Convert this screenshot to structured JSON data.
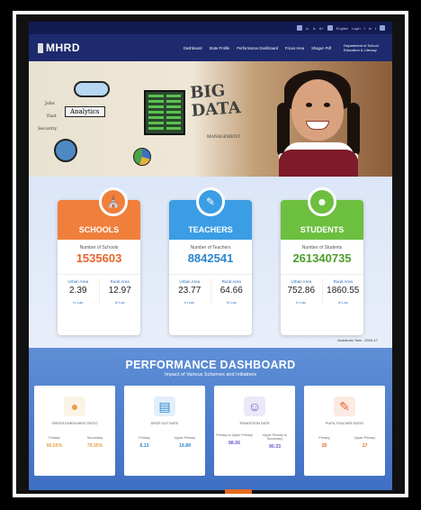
{
  "topbar": {
    "items": [
      "A-",
      "A",
      "A+",
      "English",
      "Login"
    ],
    "social": [
      "f",
      "in",
      "t"
    ]
  },
  "nav": {
    "brand": "MHRD",
    "menu": [
      "Dashboard",
      "State Profile",
      "Performance Dashboard",
      "Focus Area",
      "Shagun Pdf"
    ],
    "dept": "Department of School Education & Literacy"
  },
  "hero": {
    "big": "BIG",
    "data": "DATA",
    "analytics": "Analytics",
    "doodles": [
      "Jobs",
      "Fast",
      "Security",
      "MANAGEMENT"
    ]
  },
  "stats": {
    "cards": [
      {
        "title": "SCHOOLS",
        "label": "Number of Schools",
        "value": "1535603",
        "urban_label": "Urban Area",
        "urban": "2.39",
        "rural_label": "Rural Area",
        "rural": "12.97",
        "unit": "In Lac",
        "color": "#f07f3c",
        "valcolor": "#e8642a"
      },
      {
        "title": "TEACHERS",
        "label": "Number of Teachers",
        "value": "8842541",
        "urban_label": "Urban Area",
        "urban": "23.77",
        "rural_label": "Rural Area",
        "rural": "64.66",
        "unit": "In Lac",
        "color": "#3b9de4",
        "valcolor": "#2a86d0"
      },
      {
        "title": "STUDENTS",
        "label": "Number of Students",
        "value": "261340735",
        "urban_label": "Urban Area",
        "urban": "752.86",
        "rural_label": "Rural Area",
        "rural": "1860.55",
        "unit": "In Lac",
        "color": "#6cbf3f",
        "valcolor": "#4c9f2a"
      }
    ],
    "year": "Academic Year : 2016-17"
  },
  "perf": {
    "title": "PERFORMANCE DASHBOARD",
    "subtitle": "Impact of Various Schemes and Initiatives",
    "cards": [
      {
        "title": "GROSS ENROLMENT RATIO",
        "k1": "Primary",
        "v1": "95.55%",
        "k2": "Secondary",
        "v2": "79.35%",
        "color": "#e6a24a",
        "icon": "coins-icon"
      },
      {
        "title": "DROP OUT RATE",
        "k1": "Primary",
        "v1": "6.13",
        "k2": "Upper Primary",
        "v2": "19.89",
        "color": "#2a86d0",
        "icon": "chart-icon"
      },
      {
        "title": "TRANSITION RATE",
        "k1": "Primary to Upper Primary",
        "v1": "88.56",
        "k2": "Upper Primary to Secondary",
        "v2": "90.33",
        "color": "#6a5ac8",
        "icon": "teacher-icon"
      },
      {
        "title": "PUPIL TEACHER RATIO",
        "k1": "Primary",
        "v1": "25",
        "k2": "Upper Primary",
        "v2": "17",
        "color": "#e8642a",
        "icon": "board-icon"
      }
    ]
  }
}
